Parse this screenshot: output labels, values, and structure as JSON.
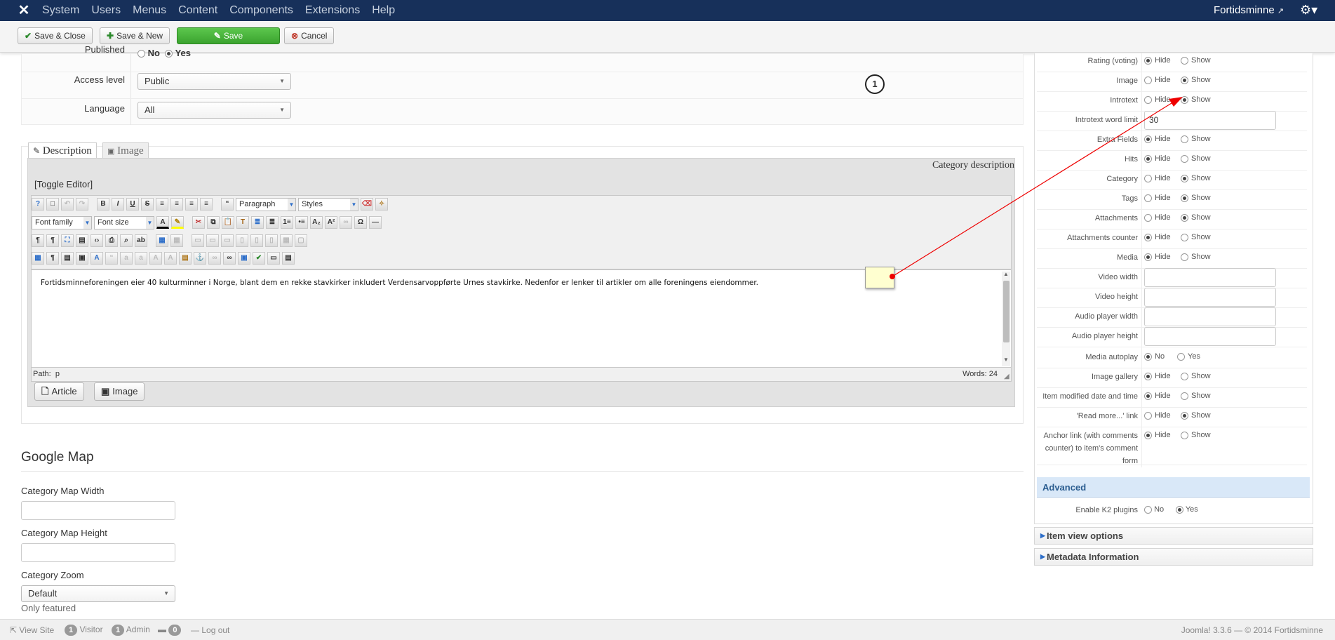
{
  "navbar": {
    "menu": [
      "System",
      "Users",
      "Menus",
      "Content",
      "Components",
      "Extensions",
      "Help"
    ],
    "site_name": "Fortidsminne"
  },
  "toolbar": {
    "save_close": "Save & Close",
    "save_new": "Save & New",
    "save": "Save",
    "cancel": "Cancel"
  },
  "form": {
    "published_label": "Published",
    "published_no": "No",
    "published_yes": "Yes",
    "access_label": "Access level",
    "access_value": "Public",
    "language_label": "Language",
    "language_value": "All"
  },
  "annotation": {
    "number": "1"
  },
  "editor": {
    "tab_description": "Description",
    "tab_image": "Image",
    "heading": "Category description",
    "toggle": "[Toggle Editor]",
    "format_select": "Paragraph",
    "styles_select": "Styles",
    "font_family": "Font family",
    "font_size": "Font size",
    "content": "Fortidsminneforeningen eier 40 kulturminner i Norge, blant dem en rekke stavkirker inkludert Verdensarvoppførte Urnes stavkirke. Nedenfor er lenker til artikler om alle foreningens eiendommer.",
    "path_label": "Path:",
    "path_value": "p",
    "words": "Words: 24",
    "btn_article": "Article",
    "btn_image": "Image"
  },
  "google_map": {
    "title": "Google Map",
    "width_label": "Category Map Width",
    "height_label": "Category Map Height",
    "zoom_label": "Category Zoom",
    "zoom_value": "Default",
    "only_featured": "Only featured"
  },
  "right_panel": {
    "rows": [
      {
        "label": "Rating (voting)",
        "a": "Hide",
        "b": "Show",
        "sel": "a"
      },
      {
        "label": "Image",
        "a": "Hide",
        "b": "Show",
        "sel": "b"
      },
      {
        "label": "Introtext",
        "a": "Hide",
        "b": "Show",
        "sel": "b"
      },
      {
        "label": "Introtext word limit",
        "input": "30"
      },
      {
        "label": "Extra Fields",
        "a": "Hide",
        "b": "Show",
        "sel": "a"
      },
      {
        "label": "Hits",
        "a": "Hide",
        "b": "Show",
        "sel": "a"
      },
      {
        "label": "Category",
        "a": "Hide",
        "b": "Show",
        "sel": "b"
      },
      {
        "label": "Tags",
        "a": "Hide",
        "b": "Show",
        "sel": "b"
      },
      {
        "label": "Attachments",
        "a": "Hide",
        "b": "Show",
        "sel": "b"
      },
      {
        "label": "Attachments counter",
        "a": "Hide",
        "b": "Show",
        "sel": "a"
      },
      {
        "label": "Media",
        "a": "Hide",
        "b": "Show",
        "sel": "a"
      },
      {
        "label": "Video width",
        "input": ""
      },
      {
        "label": "Video height",
        "input": ""
      },
      {
        "label": "Audio player width",
        "input": ""
      },
      {
        "label": "Audio player height",
        "input": ""
      },
      {
        "label": "Media autoplay",
        "a": "No",
        "b": "Yes",
        "sel": "a"
      },
      {
        "label": "Image gallery",
        "a": "Hide",
        "b": "Show",
        "sel": "a"
      },
      {
        "label": "Item modified date and time",
        "a": "Hide",
        "b": "Show",
        "sel": "a"
      },
      {
        "label": "'Read more...' link",
        "a": "Hide",
        "b": "Show",
        "sel": "b"
      },
      {
        "label": "Anchor link (with comments counter) to item's comment form",
        "a": "Hide",
        "b": "Show",
        "sel": "a"
      }
    ],
    "advanced_title": "Advanced",
    "k2_label": "Enable K2 plugins",
    "k2_no": "No",
    "k2_yes": "Yes",
    "item_view_options": "Item view options",
    "metadata_information": "Metadata Information"
  },
  "status": {
    "view_site": "View Site",
    "visitor_count": "1",
    "visitor_label": "Visitor",
    "admin_count": "1",
    "admin_label": "Admin",
    "messages_count": "0",
    "logout": "Log out",
    "version": "Joomla! 3.3.6 — © 2014 Fortidsminne"
  }
}
